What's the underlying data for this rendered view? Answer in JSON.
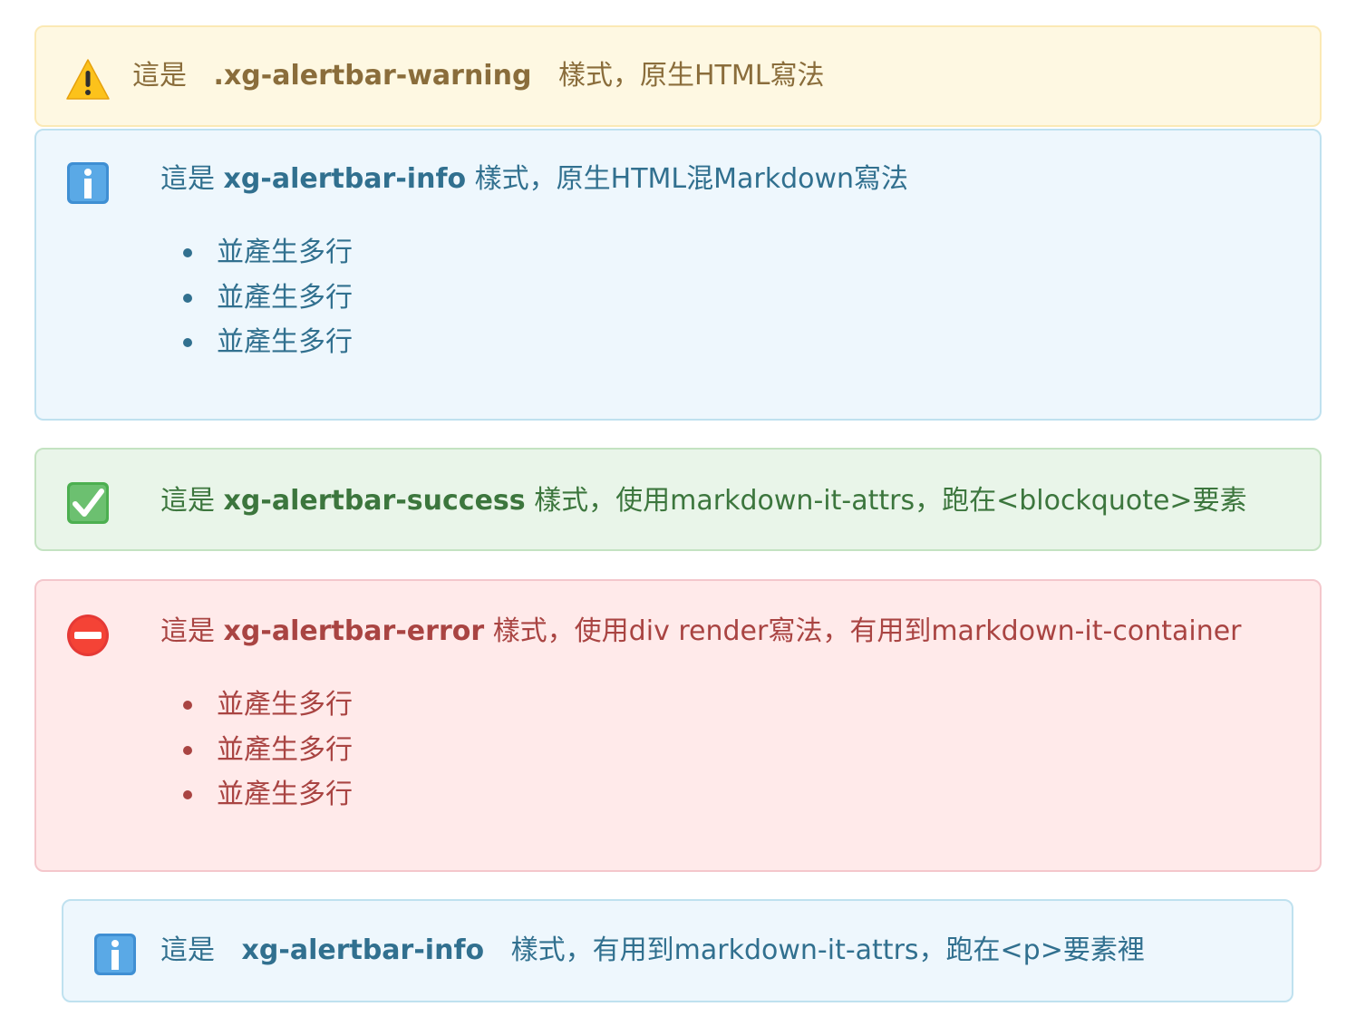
{
  "colors": {
    "warning_bg": "#fef8e2",
    "warning_text": "#8a6d3b",
    "info_bg": "#eef7fd",
    "info_text": "#31708f",
    "success_bg": "#e9f5e9",
    "success_text": "#3c763d",
    "error_bg": "#ffeaea",
    "error_text": "#a94442"
  },
  "warning": {
    "icon": "warning-icon",
    "prefix": "這是",
    "class_name": ".xg-alertbar-warning",
    "suffix": "樣式，原生HTML寫法"
  },
  "info": {
    "icon": "info-icon",
    "prefix": "這是",
    "class_name": "xg-alertbar-info",
    "suffix": "樣式，原生HTML混Markdown寫法",
    "items": [
      "並產生多行",
      "並產生多行",
      "並產生多行"
    ]
  },
  "success": {
    "icon": "check-icon",
    "prefix": "這是",
    "class_name": "xg-alertbar-success",
    "suffix": "樣式，使用markdown-it-attrs，跑在<blockquote>要素"
  },
  "error": {
    "icon": "no-entry-icon",
    "prefix": "這是",
    "class_name": "xg-alertbar-error",
    "suffix": "樣式，使用div render寫法，有用到markdown-it-container",
    "items": [
      "並產生多行",
      "並產生多行",
      "並產生多行"
    ]
  },
  "info_p": {
    "icon": "info-icon",
    "prefix": "這是",
    "class_name": "xg-alertbar-info",
    "suffix": "樣式，有用到markdown-it-attrs，跑在<p>要素裡"
  }
}
